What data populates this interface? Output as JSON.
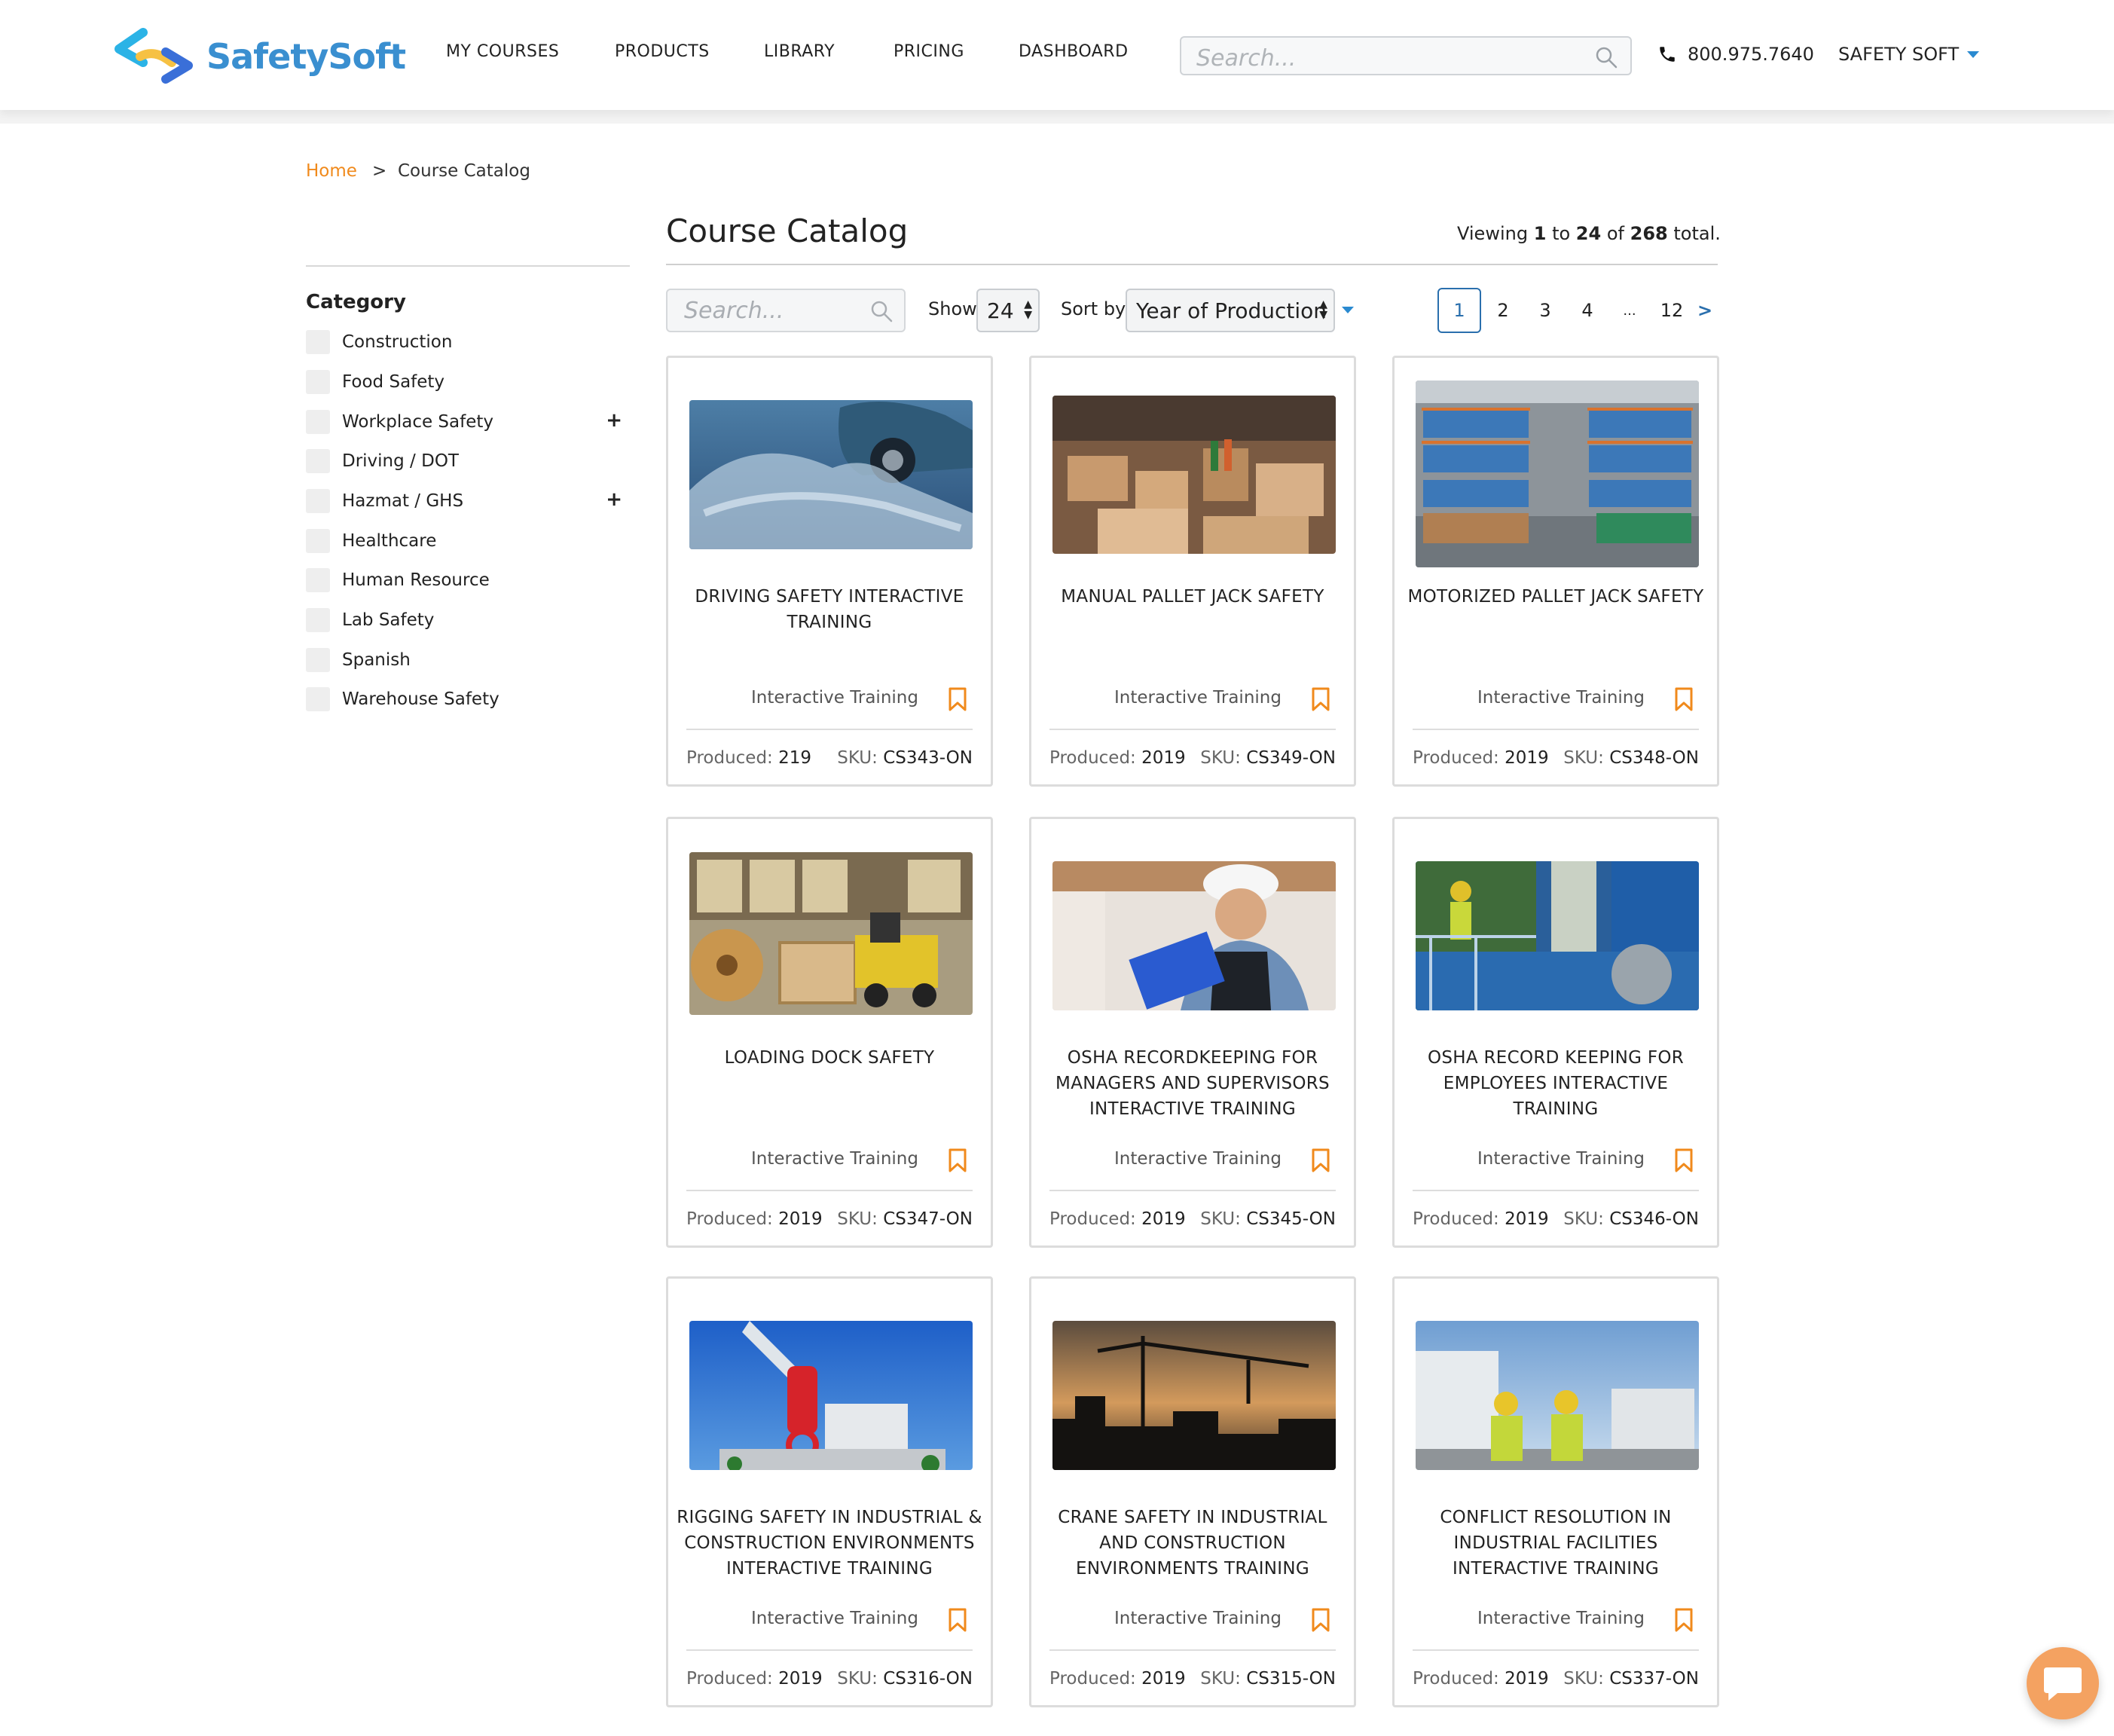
{
  "header": {
    "logo_text": "SafetySoft",
    "nav": [
      "MY COURSES",
      "PRODUCTS",
      "LIBRARY",
      "PRICING",
      "DASHBOARD"
    ],
    "search_placeholder": "Search...",
    "phone": "800.975.7640",
    "account": "SAFETY SOFT"
  },
  "breadcrumb": {
    "home": "Home",
    "separator": ">",
    "current": "Course Catalog"
  },
  "sidebar": {
    "title": "Category",
    "items": [
      {
        "label": "Construction",
        "expandable": false
      },
      {
        "label": "Food Safety",
        "expandable": false
      },
      {
        "label": "Workplace Safety",
        "expandable": true
      },
      {
        "label": "Driving / DOT",
        "expandable": false
      },
      {
        "label": "Hazmat / GHS",
        "expandable": true
      },
      {
        "label": "Healthcare",
        "expandable": false
      },
      {
        "label": "Human Resource",
        "expandable": false
      },
      {
        "label": "Lab Safety",
        "expandable": false
      },
      {
        "label": "Spanish",
        "expandable": false
      },
      {
        "label": "Warehouse Safety",
        "expandable": false
      }
    ],
    "expand_symbol": "+"
  },
  "main": {
    "title": "Course Catalog",
    "viewing": {
      "prefix": "Viewing",
      "from": "1",
      "to_word": "to",
      "to": "24",
      "of_word": "of",
      "total": "268",
      "suffix": "total."
    },
    "toolbar": {
      "search_placeholder": "Search...",
      "show_label": "Show",
      "show_value": "24",
      "sort_label": "Sort by",
      "sort_value": "Year of Production"
    },
    "pagination": {
      "pages": [
        "1",
        "2",
        "3",
        "4",
        "...",
        "12"
      ],
      "active": "1",
      "next": ">"
    }
  },
  "cards": [
    {
      "title": "DRIVING SAFETY INTERACTIVE TRAINING",
      "type": "Interactive Training",
      "produced_label": "Produced:",
      "produced": "219",
      "sku_label": "SKU:",
      "sku": "CS343-ON",
      "image": "car-splashing-water"
    },
    {
      "title": "MANUAL PALLET JACK SAFETY",
      "type": "Interactive Training",
      "produced_label": "Produced:",
      "produced": "2019",
      "sku_label": "SKU:",
      "sku": "CS349-ON",
      "image": "warehouse-boxes"
    },
    {
      "title": "MOTORIZED PALLET JACK SAFETY",
      "type": "Interactive Training",
      "produced_label": "Produced:",
      "produced": "2019",
      "sku_label": "SKU:",
      "sku": "CS348-ON",
      "image": "warehouse-racks"
    },
    {
      "title": "LOADING DOCK SAFETY",
      "type": "Interactive Training",
      "produced_label": "Produced:",
      "produced": "2019",
      "sku_label": "SKU:",
      "sku": "CS347-ON",
      "image": "forklift-warehouse"
    },
    {
      "title": "OSHA RECORDKEEPING FOR MANAGERS AND SUPERVISORS INTERACTIVE TRAINING",
      "type": "Interactive Training",
      "produced_label": "Produced:",
      "produced": "2019",
      "sku_label": "SKU:",
      "sku": "CS345-ON",
      "image": "worker-clipboard"
    },
    {
      "title": "OSHA RECORD KEEPING FOR EMPLOYEES INTERACTIVE TRAINING",
      "type": "Interactive Training",
      "produced_label": "Produced:",
      "produced": "2019",
      "sku_label": "SKU:",
      "sku": "CS346-ON",
      "image": "industrial-plant-worker"
    },
    {
      "title": "RIGGING SAFETY IN INDUSTRIAL & CONSTRUCTION ENVIRONMENTS INTERACTIVE TRAINING",
      "type": "Interactive Training",
      "produced_label": "Produced:",
      "produced": "2019",
      "sku_label": "SKU:",
      "sku": "CS316-ON",
      "image": "crane-hook-sky"
    },
    {
      "title": "CRANE SAFETY IN INDUSTRIAL AND CONSTRUCTION ENVIRONMENTS TRAINING",
      "type": "Interactive Training",
      "produced_label": "Produced:",
      "produced": "2019",
      "sku_label": "SKU:",
      "sku": "CS315-ON",
      "image": "crane-silhouette-sunset"
    },
    {
      "title": "CONFLICT RESOLUTION IN INDUSTRIAL FACILITIES INTERACTIVE TRAINING",
      "type": "Interactive Training",
      "produced_label": "Produced:",
      "produced": "2019",
      "sku_label": "SKU:",
      "sku": "CS337-ON",
      "image": "workers-handshake-tanks"
    }
  ],
  "colors": {
    "accent": "#f08a1c",
    "link": "#2a6fad",
    "logo_blue": "#3a8fd0",
    "chat": "#f4a261"
  }
}
